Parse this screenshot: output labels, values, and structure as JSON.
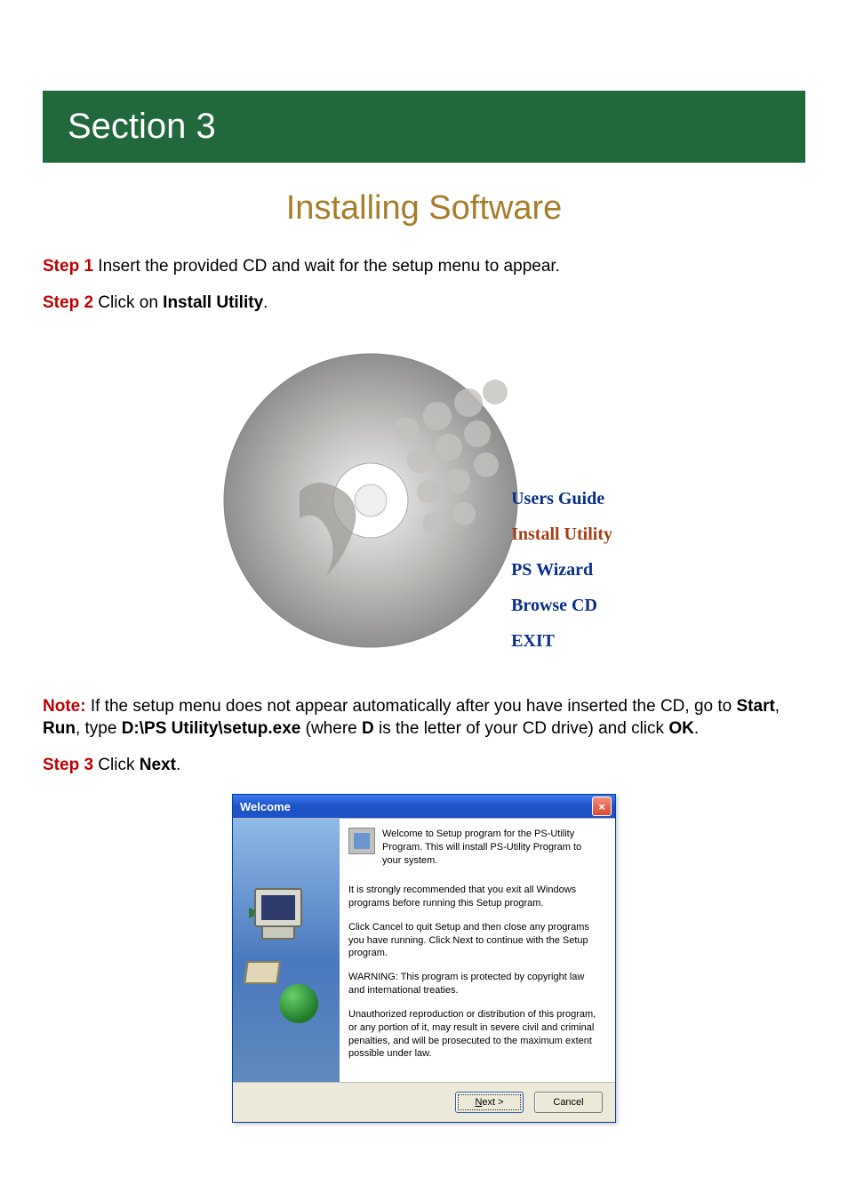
{
  "section_banner": "Section 3",
  "page_title": "Installing Software",
  "steps": {
    "s1": {
      "label": "Step 1",
      "text": " Insert the provided CD and wait for the setup menu to appear."
    },
    "s2": {
      "label": "Step 2",
      "text_a": " Click on ",
      "bold": "Install Utility",
      "text_b": "."
    },
    "s3": {
      "label": "Step 3",
      "text_a": " Click ",
      "bold": "Next",
      "text_b": "."
    }
  },
  "autorun_menu": {
    "items": [
      "Users Guide",
      "Install Utility",
      "PS Wizard",
      "Browse CD",
      "EXIT"
    ]
  },
  "note": {
    "label": "Note:",
    "text_a": " If the setup menu does not appear automatically after you have inserted the CD, go to ",
    "b1": "Start",
    "sep1": ", ",
    "b2": "Run",
    "text_b": ", type ",
    "b3": "D:\\PS Utility\\setup.exe",
    "text_c": " (where ",
    "b4": "D",
    "text_d": " is the letter of your CD drive) and click ",
    "b5": "OK",
    "text_e": "."
  },
  "dialog": {
    "title": "Welcome",
    "intro": "Welcome to Setup program for the PS-Utility Program. This will install PS-Utility Program to your system.",
    "p1": "It is strongly recommended that you exit all Windows programs before running this Setup program.",
    "p2": "Click Cancel to quit Setup and then close any programs you have running.  Click Next to continue with the Setup program.",
    "p3": "WARNING: This program is protected by copyright law and international treaties.",
    "p4": "Unauthorized reproduction or distribution of this program, or any portion of it, may result in severe civil and criminal penalties, and will be prosecuted to the maximum extent possible under law.",
    "buttons": {
      "next_u": "N",
      "next_rest": "ext >",
      "cancel": "Cancel"
    },
    "close_glyph": "×"
  }
}
